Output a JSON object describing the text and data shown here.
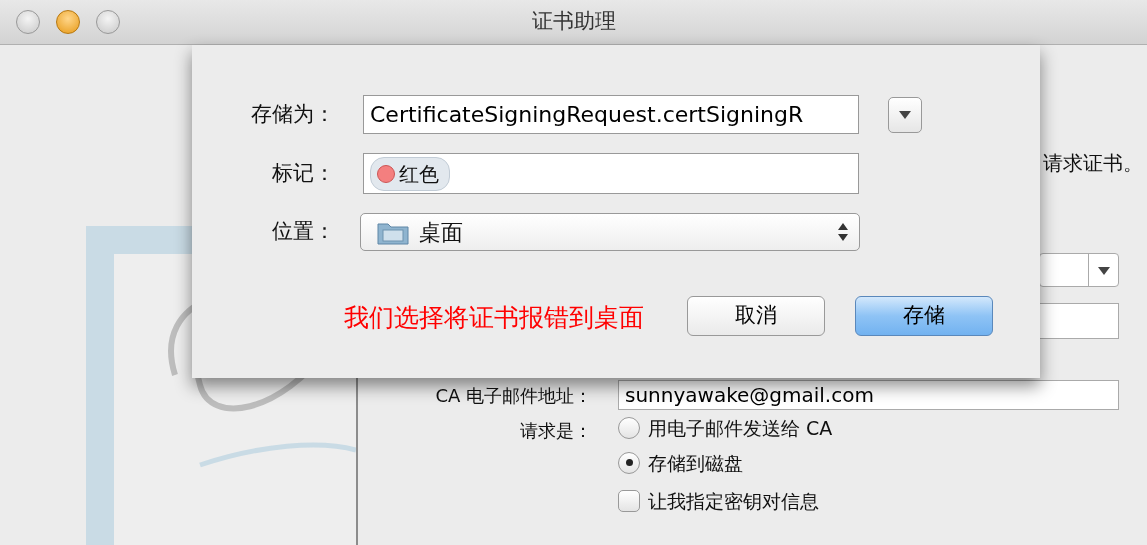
{
  "window": {
    "title": "证书助理"
  },
  "sheet": {
    "fields": [
      {
        "kind": "text",
        "label": "存储为：",
        "value": "CertificateSigningRequest.certSigningR"
      },
      {
        "kind": "tags",
        "label": "标记：",
        "tags": [
          {
            "text": "红色",
            "color": "#f47f7f"
          }
        ]
      },
      {
        "kind": "popup",
        "label": "位置：",
        "value": "桌面"
      }
    ],
    "note": "我们选择将证书报错到桌面",
    "buttons": [
      {
        "label": "取消",
        "default": false
      },
      {
        "label": "存储",
        "default": true
      }
    ]
  },
  "background": {
    "intro_tail": "请求证书。",
    "ca_email": {
      "label": "CA 电子邮件地址：",
      "value": "sunnyawake@gmail.com"
    },
    "request": {
      "label": "请求是：",
      "options": [
        {
          "label": "用电子邮件发送给 CA",
          "selected": false
        },
        {
          "label": "存储到磁盘",
          "selected": true
        }
      ],
      "checkbox": {
        "label": "让我指定密钥对信息",
        "checked": false
      }
    }
  }
}
